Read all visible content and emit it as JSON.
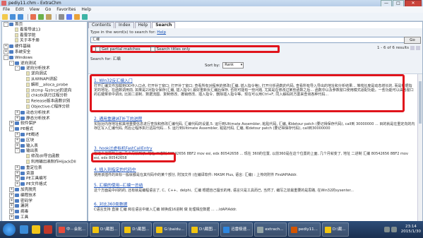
{
  "window": {
    "title": "pediy11.chm - ExtraChm",
    "buttons": [
      "—",
      "□",
      "✕"
    ]
  },
  "menu": [
    "File",
    "Edit",
    "View",
    "Go",
    "Favorites",
    "Help"
  ],
  "sidebar": {
    "items": [
      {
        "label": "首页",
        "level": 0,
        "expander": "-",
        "type": "book"
      },
      {
        "label": "看雪导读13",
        "level": 1,
        "expander": "",
        "type": "page"
      },
      {
        "label": "看雪学院",
        "level": 1,
        "expander": "",
        "type": "page"
      },
      {
        "label": "关于本手册",
        "level": 1,
        "expander": "",
        "type": "page"
      },
      {
        "label": "硬件基础",
        "level": 0,
        "expander": "+",
        "type": "book"
      },
      {
        "label": "系统安全",
        "level": 0,
        "expander": "+",
        "type": "book"
      },
      {
        "label": "Windows",
        "level": 0,
        "expander": "-",
        "type": "book"
      },
      {
        "label": "逆向测试",
        "level": 1,
        "expander": "-",
        "type": "book"
      },
      {
        "label": "逆向分析技术",
        "level": 2,
        "expander": "-",
        "type": "book"
      },
      {
        "label": "逆向调试",
        "level": 3,
        "expander": "",
        "type": "page"
      },
      {
        "label": "从WINAPI讲起",
        "level": 3,
        "expander": "",
        "type": "page"
      },
      {
        "label": "解析__alloca_probe",
        "level": 3,
        "expander": "",
        "type": "page"
      },
      {
        "label": "stcmp 与strcat的逆向",
        "level": 3,
        "expander": "",
        "type": "page"
      },
      {
        "label": "chkstk执行过程分析",
        "level": 3,
        "expander": "",
        "type": "page"
      },
      {
        "label": "Release版本函数识别",
        "level": 3,
        "expander": "",
        "type": "page"
      },
      {
        "label": "Objective-C程序分析",
        "level": 3,
        "expander": "",
        "type": "page"
      },
      {
        "label": "动态分析技术",
        "level": 2,
        "expander": "+",
        "type": "book"
      },
      {
        "label": "静态分析技术",
        "level": 2,
        "expander": "+",
        "type": "book"
      },
      {
        "label": "软件保护",
        "level": 1,
        "expander": "+",
        "type": "book"
      },
      {
        "label": "PE格式",
        "level": 1,
        "expander": "-",
        "type": "book"
      },
      {
        "label": "PE概述",
        "level": 2,
        "expander": "+",
        "type": "book"
      },
      {
        "label": "区块",
        "level": 2,
        "expander": "+",
        "type": "book"
      },
      {
        "label": "输入表",
        "level": 2,
        "expander": "+",
        "type": "book"
      },
      {
        "label": "输出表",
        "level": 2,
        "expander": "-",
        "type": "book"
      },
      {
        "label": "修改dll导出函数",
        "level": 3,
        "expander": "",
        "type": "page"
      },
      {
        "label": "利用输出表制作HijackDll",
        "level": 3,
        "expander": "",
        "type": "page"
      },
      {
        "label": "重定位表",
        "level": 2,
        "expander": "+",
        "type": "book"
      },
      {
        "label": "资源",
        "level": 2,
        "expander": "+",
        "type": "book"
      },
      {
        "label": "PE工具编写",
        "level": 2,
        "expander": "+",
        "type": "book"
      },
      {
        "label": "PE文件格式",
        "level": 2,
        "expander": "+",
        "type": "book"
      },
      {
        "label": "加壳脱壳",
        "level": 1,
        "expander": "+",
        "type": "book"
      },
      {
        "label": "编程技术",
        "level": 1,
        "expander": "+",
        "type": "book"
      },
      {
        "label": "密码学",
        "level": 1,
        "expander": "+",
        "type": "book"
      },
      {
        "label": "漏洞",
        "level": 1,
        "expander": "+",
        "type": "book"
      },
      {
        "label": "病毒",
        "level": 1,
        "expander": "+",
        "type": "book"
      },
      {
        "label": "工具",
        "level": 1,
        "expander": "+",
        "type": "book"
      }
    ]
  },
  "tabs": [
    {
      "label": "Contents"
    },
    {
      "label": "Index"
    },
    {
      "label": "Help"
    },
    {
      "label": "Search",
      "active": true
    }
  ],
  "search": {
    "hint_prefix": "Type in the word(s) to search for:",
    "hint_link": "Help",
    "input_value": "汇编",
    "button_label": "Go",
    "partial_label": "Get partial matches",
    "titles_label": "Search titles only",
    "results_info": "1 - 6 of 6 results",
    "found_label": "Search for: 汇编",
    "sort_label": "Sort by:",
    "sort_value": "Rank"
  },
  "results": [
    {
      "title": "1. Win32反汇编入门",
      "body": "打开汇编文件加载到OD中入口点, 打开补丁窗口: 打开补丁窗口; 查看所有对程序的修改(汇编, 插入指令等), 打开分析函数的代码, 查看所有导入导出的地址和分析结果... 堆栈长度是动态增长的, 而是根据指定的地址。在函数调用前, 如果是2对指令保存(汇编, 插入指令) 最好重新反汇编后保存, 否则可能有一些问题, 尤其是在修改过某些函数之后... 函数中以及参数窗口使用模式适配功能。一些功能可以由各窗口的右键菜单中调出, 比如二进制、数据流图、复制修改、撤销修改、插入指令、删除插入指令等。现在可以用Ctrl+F, 同入解码的方案来查询各种代码..."
    },
    {
      "title": "2. 通用重建IAT补丁的进程",
      "body": "实际对内存地址和其他重要信息进行查找和修改汇编代码, 汇编代码的设置,5. 运行到Ultimate Assembler, 粘贴代码, 汇编, 和detour patch (要记得保存代码), call到 30000000 ... 目的就是在重定向的内存区写入汇编代码, 然后让程序执行这段代码... 5. 运行到Ultimate Assembler, 粘贴代码, 汇编, 和detour patch (要记得保存代码), call到30000000"
    },
    {
      "title": "3. hook过虚拟机FastCallEntry",
      "body": "在这个位置的上面, 几个月就到了, 地址 二进制 80542656 8BF2 mov esi, edx 80542658 ... 现在 360的位置, 以前360是在这个位置的上面, 几个月就变了, 地址 二进制 汇编 80542656 8BF2 mov esi, edx 80542658"
    },
    {
      "title": "4. 插入到指定的代码中",
      "body": "使用该插件的目标一般就都是在其代码中的某个部分, 附加文件 (在编译软件: MASM Plus, 语言: 汇编) : 上传的附件 FindAPIAddr."
    },
    {
      "title": "5. 汇编的使用--汇编一总结",
      "body": "这个方面是中间的的, 还有就是编程语言了, C、C++、delphi、汇编 根据自己擅长的用, 语言只是工具而已, 当然了, 编写之前最重要的是思路, 在Win32的sysenter..."
    },
    {
      "title": "6. 对比360类数据",
      "body": "C语言支持 直接 汇编 和在语言中嵌入汇编 转换成16进制 做 处理相应数据 ...             ...ldAPIAddr."
    }
  ],
  "taskbar": {
    "tasks": [
      {
        "label": "中···会批..."
      },
      {
        "label": "D:\\截图..."
      },
      {
        "label": "D:\\截图..."
      },
      {
        "label": "G:\\baidu..."
      },
      {
        "label": "D:\\截图..."
      },
      {
        "label": "迅雷极速..."
      },
      {
        "label": "extrach..."
      },
      {
        "label": "pediy11..."
      },
      {
        "label": "D:\\截..."
      }
    ],
    "time": "23:14",
    "date": "2015/1/30"
  },
  "colors": {
    "highlight": "#e0141c",
    "link": "#1a4fb8",
    "taskbar": "#1a2f4f"
  }
}
